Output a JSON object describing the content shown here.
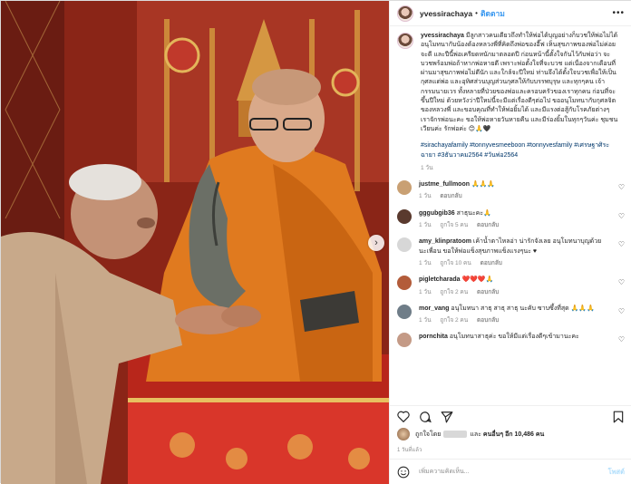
{
  "post": {
    "username": "yvessirachaya",
    "follow_label": "ติดตาม",
    "dot": "•",
    "more_label": "•••"
  },
  "caption": {
    "username": "yvessirachaya",
    "text": "มีลูกสาวคนเดียวถึงทำให้พ่อได้บุญอย่างก็บวชให้พ่อไม่ได้ อนุโมทนากับน้องต้องหลวงพี่ที่คิดถึงพ่อของอี๊ฟ เห็นสุขภาพของพ่อไม่ค่อยจะดี และปีนี้พ่อเครียดหนักมาตลอดปี ก่อนหน้านี้ตั้งใจกันไว้กับพ่อว่า จะบวชพร้อมพ่อถ้าหากพ่อหายดี เพราะพ่อตั้งใจที่จะบวช แต่เนื่องจากเดือนที่ผ่านมาสุขภาพพ่อไม่ดีนัก และใกล้จะปีใหม่ ท่านจึงได้ตั้งใจบวชเพื่อให้เป็นกุศลแด่พ่อ และอุทิศส่วนบุญส่วนกุศลให้กับบรรพบุรุษ และทุกๆคน เจ้ากรรมนายเวร ทั้งหลายที่ป่วยของพ่อและครอบครัวของเราทุกคน ก่อนที่จะขึ้นปีใหม่ ด้วยหวังว่าปีใหม่นี้จะมีแต่เรื่องดีๆต่อไป ขออนุโมทนากับกุศลจิตของหลวงพี่ และขอบคุณที่ทำให้พ่อยิ้มได้ และมีแรงต่อสู้กับโรคภัยต่างๆ เราจักรพ่อนะคะ ขอให้พ่อหายวันหายคืน และมีร่องยิ้มในทุกๆวันค่ะ ชุมชนเวียนค่ะ รักพ่อค่ะ 😊🙏🖤",
    "hashtags": "#sirachayafamily #tonnyvesmeeboon #tonnyvesfamily #เศรษฐาศิระฉายา #3ธันวาคม2564 #วันพ่อ2564",
    "time": "1 วัน"
  },
  "comments": [
    {
      "username": "justme_fullmoon",
      "text": "🙏🙏🙏",
      "time": "1 วัน",
      "likes": "",
      "reply": "ตอบกลับ",
      "avatar_color": "#c9a073"
    },
    {
      "username": "gggubgib36",
      "text": "สาธุนะคะ🙏",
      "time": "1 วัน",
      "likes": "ถูกใจ 5 คน",
      "reply": "ตอบกลับ",
      "avatar_color": "#5a3a2e"
    },
    {
      "username": "amy_klinpratoom",
      "text": "เค้าน้ำตาไหลอ่า น่ารักจังเลย อนุโมทนาบุญด้วยนะเพื่อน ขอให้พ่อแข็งสุขภาพแข็งแรงๆนะ ♥",
      "time": "1 วัน",
      "likes": "ถูกใจ 10 คน",
      "reply": "ตอบกลับ",
      "avatar_color": "#d7d7d7"
    },
    {
      "username": "pigletcharada",
      "text": "❤️❤️❤️🙏",
      "time": "1 วัน",
      "likes": "ถูกใจ 2 คน",
      "reply": "ตอบกลับ",
      "avatar_color": "#b35c3a"
    },
    {
      "username": "mor_vang",
      "text": "อนุโมทนา สาธุ สาธุ สาธุ นะคับ ซาบซึ้งที่สุด 🙏🙏🙏",
      "time": "1 วัน",
      "likes": "ถูกใจ 2 คน",
      "reply": "ตอบกลับ",
      "avatar_color": "#6f7d88"
    },
    {
      "username": "pornchita",
      "text": "อนุโมทนาสาธุค่ะ ขอให้มีแต่เรื่องดีๆเข้ามานะคะ",
      "time": "",
      "likes": "",
      "reply": "",
      "avatar_color": "#c49a86"
    }
  ],
  "likes": {
    "prefix": "ถูกใจโดย",
    "and": "และ",
    "others": "คนอื่นๆ อีก 10,486 คน"
  },
  "post_time": "1 วันที่แล้ว",
  "add_comment": {
    "placeholder": "เพิ่มความคิดเห็น...",
    "post_label": "โพสต์"
  },
  "icons": {
    "like": "heart-icon",
    "comment": "comment-icon",
    "share": "share-icon",
    "save": "bookmark-icon",
    "emoji": "emoji-icon",
    "carousel_next": "chevron-right-icon"
  },
  "colors": {
    "link": "#3897f0",
    "hashtag": "#00376b",
    "muted": "#8e8e8e",
    "robe": "#e07a1f"
  }
}
